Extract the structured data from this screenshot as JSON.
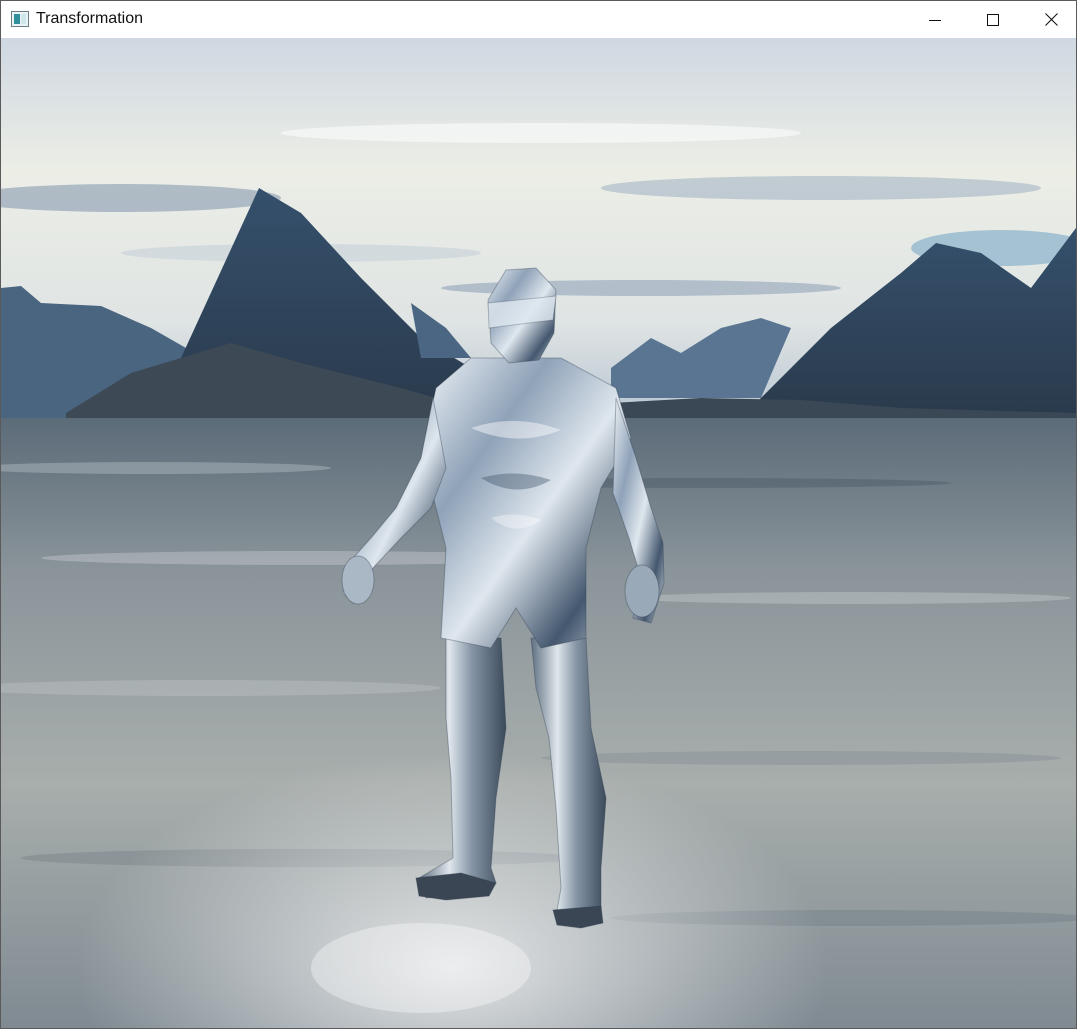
{
  "window": {
    "title": "Transformation",
    "controls": {
      "minimize_icon": "minimize-icon",
      "maximize_icon": "maximize-icon",
      "close_icon": "close-icon"
    }
  },
  "scene": {
    "skybox": "mountain-lake-skybox",
    "model": "reflective-chrome-humanoid-model",
    "colors": {
      "sky_top": "#d8dee6",
      "sky_horizon": "#eef0ea",
      "mountain": "#3f5670",
      "mountain_dark": "#2e3f52",
      "water_far": "#6f7d87",
      "water_near": "#aeb4b4",
      "chrome_light": "#e8eef4",
      "chrome_dark": "#3a4c63"
    }
  }
}
